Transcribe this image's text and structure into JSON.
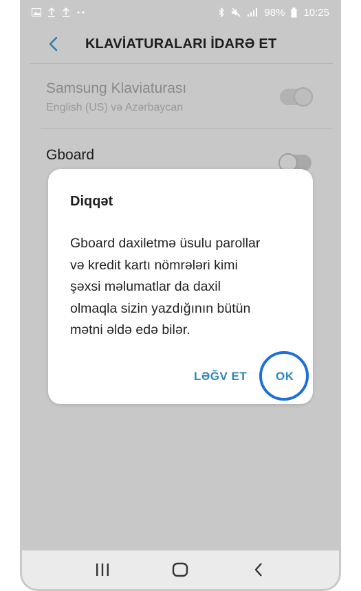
{
  "status_bar": {
    "battery_text": "98%",
    "time": "10:25",
    "left_icons": [
      "gallery-icon",
      "upload-icon",
      "upload-icon",
      "dots-icon"
    ],
    "right_icons": [
      "bluetooth-icon",
      "mute-icon",
      "signal-icon",
      "battery-icon"
    ]
  },
  "app_bar": {
    "title": "KLAVİATURALARI İDARƏ ET"
  },
  "list": {
    "items": [
      {
        "title": "Samsung Klaviaturası",
        "subtitle": "English (US) və Azərbaycan",
        "enabled": true,
        "disabled_look": true
      },
      {
        "title": "Gboard",
        "subtitle": "",
        "enabled": false,
        "disabled_look": false
      }
    ]
  },
  "dialog": {
    "title": "Diqqət",
    "body_lines": [
      "Gboard daxiletmə üsulu parollar",
      "və kredit kartı nömrələri kimi",
      "şəxsi məlumatlar da daxil",
      "olmaqla sizin yazdığının bütün",
      "mətni əldə edə bilər."
    ],
    "cancel_label": "LƏĞV ET",
    "ok_label": "OK"
  },
  "colors": {
    "accent": "#2e86b8",
    "highlight": "#1e6fd8",
    "scrim": "#c8c8c8"
  }
}
